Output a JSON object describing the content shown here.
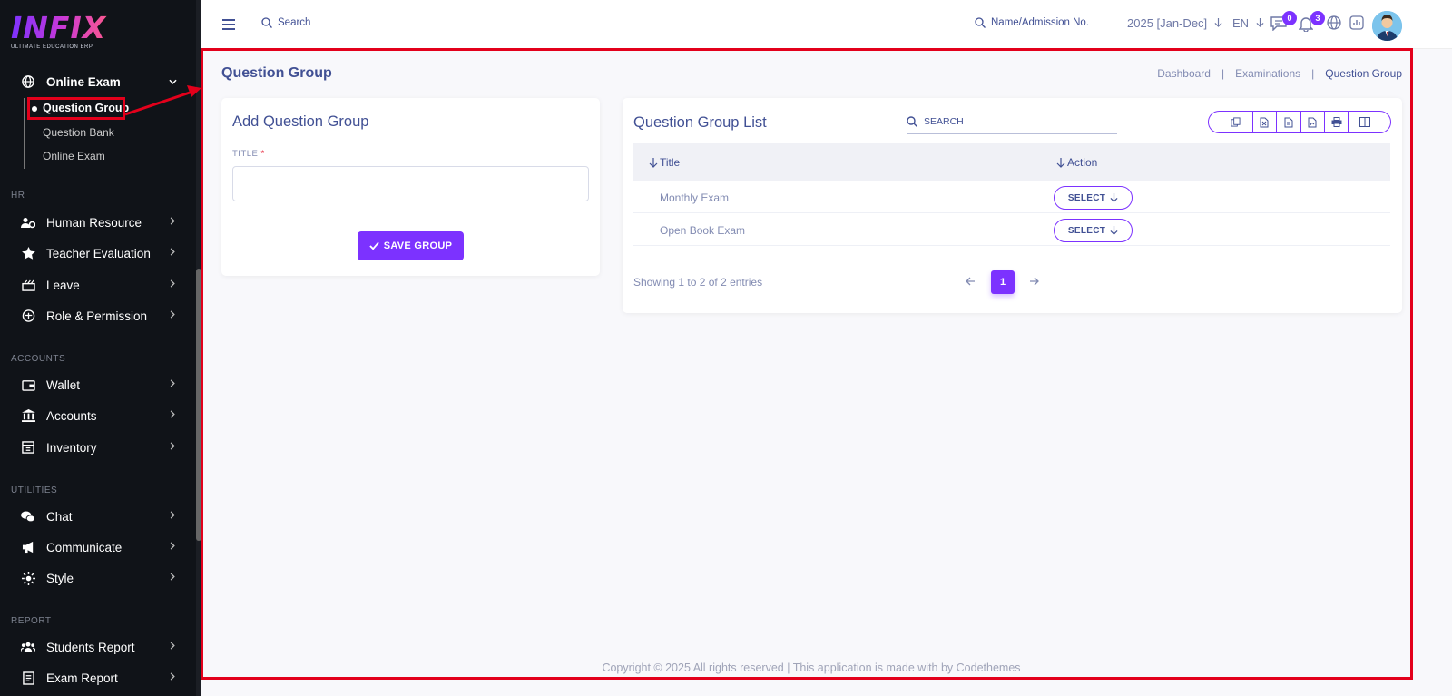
{
  "brand": {
    "logo_text": "INFIX",
    "logo_sub": "ULTIMATE EDUCATION ERP"
  },
  "sidebar": {
    "online_exam": {
      "label": "Online Exam",
      "icon": "globe-icon"
    },
    "sub_items": [
      "Question Group",
      "Question Bank",
      "Online Exam"
    ],
    "sections": {
      "hr": "HR",
      "accounts": "ACCOUNTS",
      "utilities": "UTILITIES",
      "report": "REPORT"
    },
    "hr_items": [
      {
        "label": "Human Resource",
        "icon": "users-cog-icon"
      },
      {
        "label": "Teacher Evaluation",
        "icon": "star-icon"
      },
      {
        "label": "Leave",
        "icon": "leave-icon"
      },
      {
        "label": "Role & Permission",
        "icon": "permission-icon"
      }
    ],
    "accounts_items": [
      {
        "label": "Wallet",
        "icon": "wallet-icon"
      },
      {
        "label": "Accounts",
        "icon": "bank-icon"
      },
      {
        "label": "Inventory",
        "icon": "inventory-icon"
      }
    ],
    "utilities_items": [
      {
        "label": "Chat",
        "icon": "chat-icon"
      },
      {
        "label": "Communicate",
        "icon": "megaphone-icon"
      },
      {
        "label": "Style",
        "icon": "style-icon"
      }
    ],
    "report_items": [
      {
        "label": "Students Report",
        "icon": "users-icon"
      },
      {
        "label": "Exam Report",
        "icon": "report-icon"
      }
    ]
  },
  "topbar": {
    "search_label": "Search",
    "student_search_label": "Name/Admission No.",
    "academic_year": "2025 [Jan-Dec]",
    "language": "EN",
    "chat_badge": "0",
    "notification_badge": "3"
  },
  "page": {
    "title": "Question Group",
    "breadcrumb": [
      "Dashboard",
      "Examinations",
      "Question Group"
    ]
  },
  "add_form": {
    "heading": "Add Question Group",
    "title_label": "TITLE",
    "required_mark": "*",
    "title_value": "",
    "save_label": "SAVE GROUP"
  },
  "list": {
    "heading": "Question Group List",
    "search_placeholder": "SEARCH",
    "columns": [
      "Title",
      "Action"
    ],
    "rows": [
      {
        "title": "Monthly Exam",
        "action": "SELECT"
      },
      {
        "title": "Open Book Exam",
        "action": "SELECT"
      }
    ],
    "showing": "Showing 1 to 2 of 2 entries",
    "current_page": "1"
  },
  "footer": {
    "text": "Copyright © 2025 All rights reserved | This application is made with by Codethemes"
  },
  "colors": {
    "accent": "#7c32ff",
    "highlight": "#e3001b",
    "sidebar_bg": "#101318",
    "text": "#415094"
  }
}
